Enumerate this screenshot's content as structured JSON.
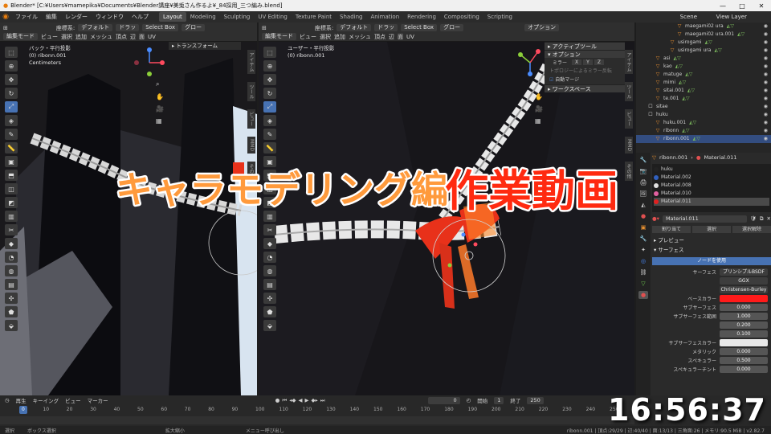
{
  "window": {
    "title": "Blender* [C:¥Users¥mamepika¥Documents¥Blender講座¥美兎さん作るよ¥_84採用_三つ編み.blend]",
    "controls": [
      "—",
      "□",
      "✕"
    ]
  },
  "menubar": {
    "menus": [
      "ファイル",
      "編集",
      "レンダー",
      "ウィンドウ",
      "ヘルプ"
    ],
    "workspaces": [
      "Layout",
      "Modeling",
      "Sculpting",
      "UV Editing",
      "Texture Paint",
      "Shading",
      "Animation",
      "Rendering",
      "Compositing",
      "Scripting"
    ],
    "active_workspace": "Layout",
    "scene": "Scene",
    "view_layer": "View Layer"
  },
  "left_header": {
    "row1": [
      "座標系:",
      "デフォルト",
      "ドラッ",
      "Select Box",
      "グロー"
    ],
    "mode": "編集モード",
    "row2": [
      "ビュー",
      "選択",
      "追加",
      "メッシュ",
      "頂点",
      "辺",
      "面",
      "UV"
    ]
  },
  "right_header": {
    "row1": [
      "座標系:",
      "デフォルト",
      "ドラッ",
      "Select Box",
      "グロー",
      "オプション"
    ],
    "mode": "編集モード",
    "row2": [
      "ビュー",
      "選択",
      "追加",
      "メッシュ",
      "頂点",
      "辺",
      "面",
      "UV"
    ]
  },
  "left_viewport": {
    "info": [
      "バック・平行投影",
      "(0) ribonn.001",
      "Centimeters"
    ],
    "panel": "▸ トランスフォーム",
    "side_tabs": [
      "アイテム",
      "ツール",
      "ビュー",
      "MMD",
      "その他"
    ]
  },
  "right_viewport": {
    "info": [
      "ユーザー・平行投影",
      "(0) ribonn.001"
    ],
    "npanel": {
      "active_tool": "▸ アクティブツール",
      "options": "▾ オプション",
      "mirror_label": "ミラー",
      "mirror_axes": [
        "X",
        "Y",
        "Z"
      ],
      "topology": "トポロジーによるミラー反転",
      "auto_merge": "自動マージ",
      "workspace": "▸ ワークスペース"
    },
    "side_tabs": [
      "アイテム",
      "ツール",
      "ビュー",
      "MMD",
      "その他"
    ]
  },
  "outliner": {
    "rows": [
      {
        "name": "maegami02 ura",
        "indent": 4,
        "icon": "▽",
        "sel": false
      },
      {
        "name": "maegami02 ura.001",
        "indent": 4,
        "icon": "▽",
        "sel": false
      },
      {
        "name": "usirogami",
        "indent": 3,
        "icon": "▽",
        "sel": false
      },
      {
        "name": "usirogami ura",
        "indent": 3,
        "icon": "▽",
        "sel": false
      },
      {
        "name": "asi",
        "indent": 1,
        "icon": "▽",
        "sel": false
      },
      {
        "name": "kao",
        "indent": 1,
        "icon": "▽",
        "sel": false
      },
      {
        "name": "matuge",
        "indent": 1,
        "icon": "▽",
        "sel": false
      },
      {
        "name": "mimi",
        "indent": 1,
        "icon": "▽",
        "sel": false
      },
      {
        "name": "sitai.001",
        "indent": 1,
        "icon": "▽",
        "sel": false
      },
      {
        "name": "te.001",
        "indent": 1,
        "icon": "▽",
        "sel": false
      },
      {
        "name": "sitae",
        "indent": 0,
        "icon": "☐",
        "sel": false
      },
      {
        "name": "huku",
        "indent": 0,
        "icon": "☐",
        "sel": false
      },
      {
        "name": "huku.001",
        "indent": 1,
        "icon": "▽",
        "sel": false
      },
      {
        "name": "ribonn",
        "indent": 1,
        "icon": "▽",
        "sel": false
      },
      {
        "name": "ribonn.001",
        "indent": 1,
        "icon": "▽",
        "sel": true
      }
    ]
  },
  "properties": {
    "crumb_object": "ribonn.001",
    "crumb_material": "Material.011",
    "materials": [
      {
        "name": "huku",
        "color": "#222222"
      },
      {
        "name": "Material.002",
        "color": "#3060c0"
      },
      {
        "name": "Material.008",
        "color": "#e0e0e0"
      },
      {
        "name": "Material.010",
        "color": "#e060a0"
      },
      {
        "name": "Material.011",
        "color": "#e02020"
      }
    ],
    "selected_material_index": 4,
    "slot_name": "Material.011",
    "assign_buttons": [
      "割り当て",
      "選択",
      "選択解除"
    ],
    "preview": "▸ プレビュー",
    "surface": "▾ サーフェス",
    "use_nodes": "ノードを使用",
    "surface_shader_label": "サーフェス",
    "surface_shader": "プリンシプルBSDF",
    "distribution": "GGX",
    "subsurface_method": "Christensen-Burley",
    "props": [
      {
        "label": "ベースカラー",
        "value": "",
        "kind": "color",
        "color": "#ff1a1a"
      },
      {
        "label": "サブサーフェス",
        "value": "0.000",
        "kind": "num"
      },
      {
        "label": "サブサーフェス範囲",
        "value": "1.000",
        "kind": "num"
      },
      {
        "label": "",
        "value": "0.200",
        "kind": "num"
      },
      {
        "label": "",
        "value": "0.100",
        "kind": "num"
      },
      {
        "label": "サブサーフェスカラー",
        "value": "",
        "kind": "color",
        "color": "#e8e8e8"
      },
      {
        "label": "メタリック",
        "value": "0.000",
        "kind": "num"
      },
      {
        "label": "スペキュラー",
        "value": "0.500",
        "kind": "num"
      },
      {
        "label": "スペキュラーチント",
        "value": "0.000",
        "kind": "num"
      }
    ]
  },
  "timeline": {
    "controls": [
      "再生",
      "キーイング",
      "ビュー",
      "マーカー"
    ],
    "current_frame": "0",
    "start_label": "開始",
    "start": "1",
    "end_label": "終了",
    "end": "250",
    "ruler": [
      "0",
      "10",
      "20",
      "30",
      "40",
      "50",
      "60",
      "70",
      "80",
      "90",
      "100",
      "110",
      "120",
      "130",
      "140",
      "150",
      "160",
      "170",
      "180",
      "190",
      "200",
      "210",
      "220",
      "230",
      "240",
      "250"
    ]
  },
  "statusbar": {
    "items": [
      "選択",
      "ボックス選択",
      "拡大縮小",
      "メニュー呼び出し"
    ],
    "right": "ribonn.001 | 頂点:29/29 | 辺:40/40 | 面:13/13 | 三角面:26 | メモリ:90.5 MiB | v2.82.7"
  },
  "overlay": {
    "title_orange": "キャラモデリング編",
    "title_red": "作業動画",
    "clock": "16:56:37"
  },
  "colors": {
    "accent_blue": "#4772b3",
    "title_orange": "#ff9a3c",
    "title_red": "#ff2a10",
    "ribbon_red": "#e8311a"
  }
}
